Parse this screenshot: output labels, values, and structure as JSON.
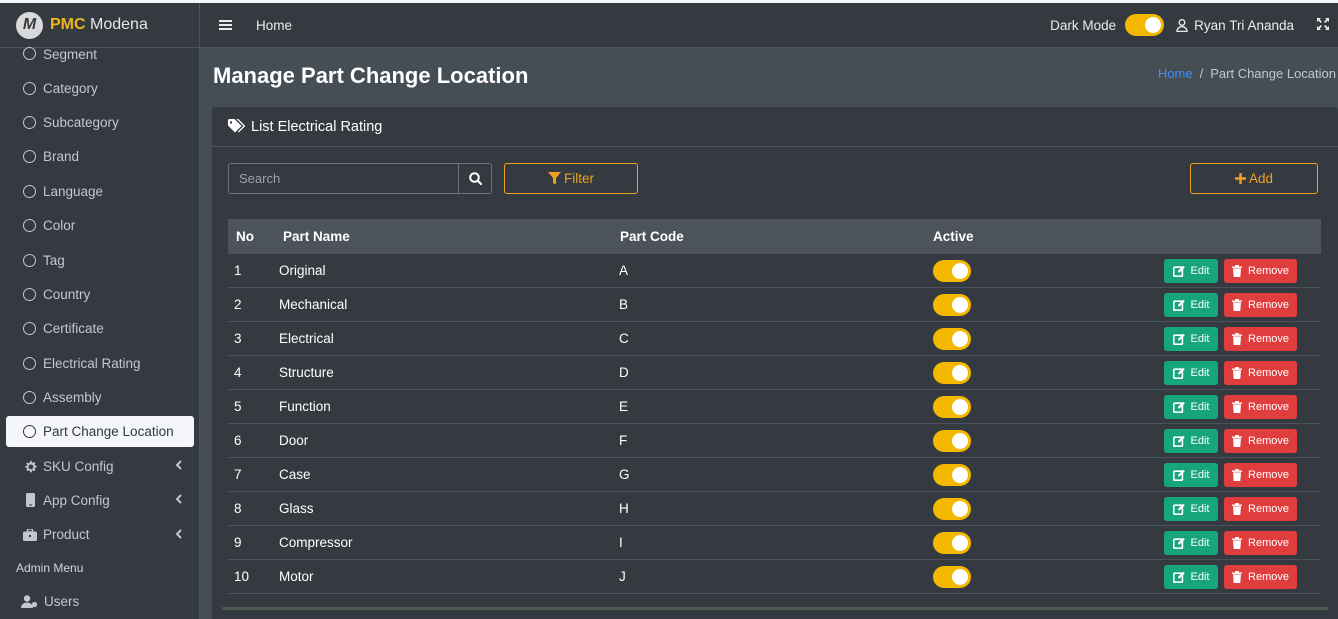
{
  "brand": {
    "logo_letter": "M",
    "name_bold": "PMC",
    "name_light": "Modena"
  },
  "sidebar": {
    "items": [
      {
        "label": "Segment"
      },
      {
        "label": "Category"
      },
      {
        "label": "Subcategory"
      },
      {
        "label": "Brand"
      },
      {
        "label": "Language"
      },
      {
        "label": "Color"
      },
      {
        "label": "Tag"
      },
      {
        "label": "Country"
      },
      {
        "label": "Certificate"
      },
      {
        "label": "Electrical Rating"
      },
      {
        "label": "Assembly"
      },
      {
        "label": "Part Change Location",
        "active": true
      }
    ],
    "groups": [
      {
        "label": "SKU Config",
        "icon": "gear-icon"
      },
      {
        "label": "App Config",
        "icon": "mobile-icon"
      },
      {
        "label": "Product",
        "icon": "briefcase-icon"
      }
    ],
    "header": "Admin Menu",
    "users": {
      "label": "Users",
      "icon": "users-icon"
    }
  },
  "topbar": {
    "home": "Home",
    "dark_mode_label": "Dark Mode",
    "dark_mode_on": true,
    "user_name": "Ryan Tri Ananda"
  },
  "page": {
    "title": "Manage Part Change Location",
    "breadcrumb_home": "Home",
    "breadcrumb_sep": "/",
    "breadcrumb_current": "Part Change Location"
  },
  "card": {
    "header": "List Electrical Rating",
    "search_placeholder": "Search",
    "filter_label": "Filter",
    "add_label": "Add"
  },
  "table": {
    "headers": {
      "no": "No",
      "name": "Part Name",
      "code": "Part Code",
      "active": "Active"
    },
    "edit_label": "Edit",
    "remove_label": "Remove",
    "rows": [
      {
        "no": "1",
        "name": "Original",
        "code": "A",
        "active": true
      },
      {
        "no": "2",
        "name": "Mechanical",
        "code": "B",
        "active": true
      },
      {
        "no": "3",
        "name": "Electrical",
        "code": "C",
        "active": true
      },
      {
        "no": "4",
        "name": "Structure",
        "code": "D",
        "active": true
      },
      {
        "no": "5",
        "name": "Function",
        "code": "E",
        "active": true
      },
      {
        "no": "6",
        "name": "Door",
        "code": "F",
        "active": true
      },
      {
        "no": "7",
        "name": "Case",
        "code": "G",
        "active": true
      },
      {
        "no": "8",
        "name": "Glass",
        "code": "H",
        "active": true
      },
      {
        "no": "9",
        "name": "Compressor",
        "code": "I",
        "active": true
      },
      {
        "no": "10",
        "name": "Motor",
        "code": "J",
        "active": true
      }
    ]
  },
  "colors": {
    "accent": "#f5b800",
    "edit": "#17a67b",
    "remove": "#e03e3e",
    "link": "#3f8ef7"
  }
}
